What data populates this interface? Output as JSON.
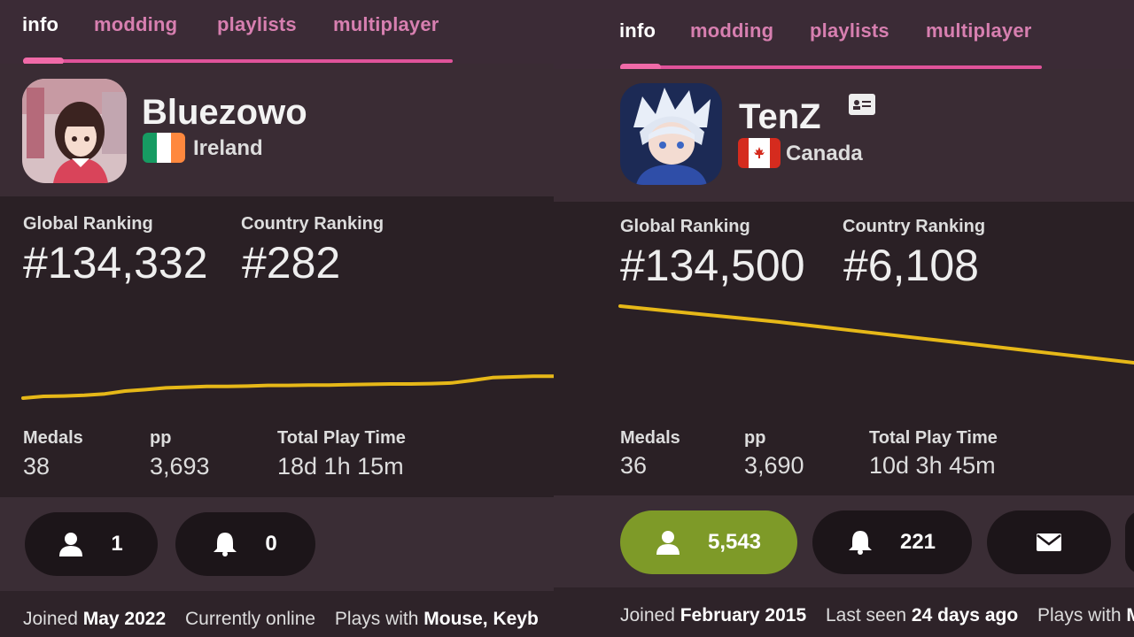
{
  "tabs": [
    "info",
    "modding",
    "playlists",
    "multiplayer"
  ],
  "ranking_labels": {
    "global": "Global Ranking",
    "country": "Country Ranking"
  },
  "stat_labels": {
    "medals": "Medals",
    "pp": "pp",
    "playtime": "Total Play Time"
  },
  "colors": {
    "accent": "#e0539a",
    "graph_line": "#e6b818",
    "follow_active": "#7e9a28"
  },
  "left": {
    "username": "Bluezowo",
    "country": "Ireland",
    "flag": "ireland",
    "global_rank": "#134,332",
    "country_rank": "#282",
    "medals": "38",
    "pp": "3,693",
    "playtime": "18d 1h 15m",
    "followers": "1",
    "subscribers": "0",
    "joined_label": "Joined",
    "joined_date": "May 2022",
    "status": "Currently online",
    "plays_with_label": "Plays with",
    "plays_with": "Mouse, Keyb",
    "rank_history": [
      0.0,
      0.05,
      0.06,
      0.08,
      0.12,
      0.2,
      0.24,
      0.29,
      0.31,
      0.33,
      0.33,
      0.34,
      0.36,
      0.36,
      0.37,
      0.37,
      0.38,
      0.39,
      0.4,
      0.4,
      0.41,
      0.43,
      0.5,
      0.58,
      0.6,
      0.62,
      0.62
    ]
  },
  "right": {
    "username": "TenZ",
    "country": "Canada",
    "flag": "canada",
    "global_rank": "#134,500",
    "country_rank": "#6,108",
    "medals": "36",
    "pp": "3,690",
    "playtime": "10d 3h 45m",
    "followers": "5,543",
    "subscribers": "221",
    "joined_label": "Joined",
    "joined_date": "February 2015",
    "lastseen_label": "Last seen",
    "lastseen": "24 days ago",
    "plays_with_label": "Plays with",
    "plays_with": "M",
    "rank_history": [
      1.0,
      0.93,
      0.86,
      0.79,
      0.72,
      0.64,
      0.56,
      0.48,
      0.4,
      0.32,
      0.24,
      0.16,
      0.08,
      0.0
    ]
  }
}
